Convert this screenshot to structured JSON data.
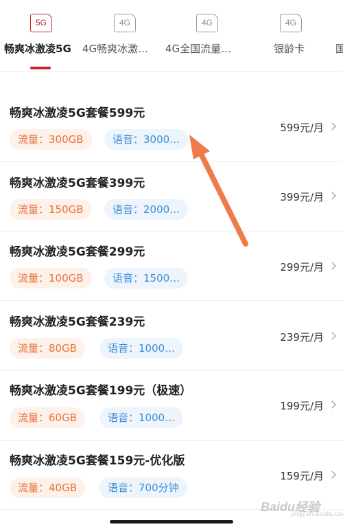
{
  "tabs": [
    {
      "icon": "5G",
      "label": "畅爽冰激凌5G",
      "active": true
    },
    {
      "icon": "4G",
      "label": "4G畅爽冰激…",
      "active": false
    },
    {
      "icon": "4G",
      "label": "4G全国流量…",
      "active": false
    },
    {
      "icon": "4G",
      "label": "银龄卡",
      "active": false
    },
    {
      "icon": "",
      "label": "国",
      "active": false
    }
  ],
  "plans": [
    {
      "name": "畅爽冰激凌5G套餐599元",
      "data": "流量：300GB",
      "voice": "语音：3000…",
      "price": "599元/月"
    },
    {
      "name": "畅爽冰激凌5G套餐399元",
      "data": "流量：150GB",
      "voice": "语音：2000…",
      "price": "399元/月"
    },
    {
      "name": "畅爽冰激凌5G套餐299元",
      "data": "流量：100GB",
      "voice": "语音：1500…",
      "price": "299元/月"
    },
    {
      "name": "畅爽冰激凌5G套餐239元",
      "data": "流量：80GB",
      "voice": "语音：1000…",
      "price": "239元/月"
    },
    {
      "name": "畅爽冰激凌5G套餐199元（极速）",
      "data": "流量：60GB",
      "voice": "语音：1000…",
      "price": "199元/月"
    },
    {
      "name": "畅爽冰激凌5G套餐159元-优化版",
      "data": "流量：40GB",
      "voice": "语音：700分钟",
      "price": "159元/月"
    }
  ],
  "watermark": {
    "text": "Baidu经验",
    "sub": "jingyan.baidu.com"
  },
  "colors": {
    "accent": "#c2262e",
    "data_chip": "#e5733a",
    "voice_chip": "#3a8ed8",
    "annotation_arrow": "#f07a4a"
  }
}
